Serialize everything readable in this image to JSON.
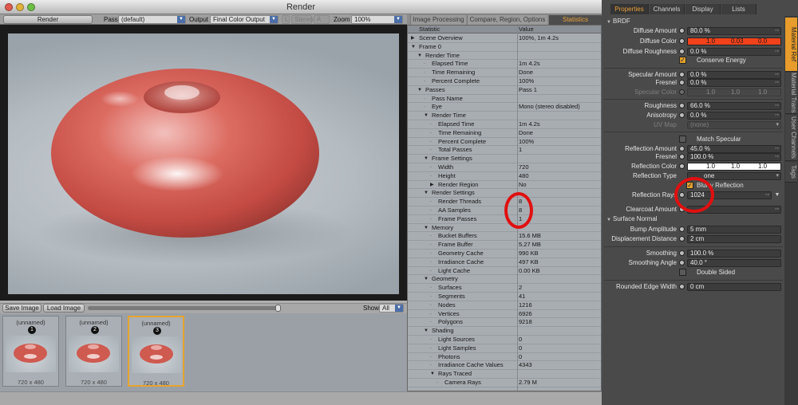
{
  "window": {
    "title": "Render"
  },
  "toolbar": {
    "render_button": "Render",
    "pass_label": "Pass",
    "pass_value": "(default)",
    "output_label": "Output",
    "output_value": "Final Color Output",
    "stereo_label": "Stereo",
    "zoom_label": "Zoom",
    "zoom_value": "100%"
  },
  "render_tabs": [
    "Image Processing",
    "Compare, Region, Options",
    "Statistics"
  ],
  "stats": {
    "headers": {
      "statistic": "Statistic",
      "value": "Value"
    },
    "rows": [
      {
        "name": "Scene Overview",
        "value": "100%, 1m 4.2s",
        "indent": 0,
        "toggle": "▶"
      },
      {
        "name": "Frame 0",
        "value": "",
        "indent": 0,
        "toggle": "▼"
      },
      {
        "name": "Render Time",
        "value": "",
        "indent": 1,
        "toggle": "▼"
      },
      {
        "name": "Elapsed Time",
        "value": "1m 4.2s",
        "indent": 2,
        "toggle": ""
      },
      {
        "name": "Time Remaining",
        "value": "Done",
        "indent": 2,
        "toggle": ""
      },
      {
        "name": "Percent Complete",
        "value": "100%",
        "indent": 2,
        "toggle": ""
      },
      {
        "name": "Passes",
        "value": "Pass 1",
        "indent": 1,
        "toggle": "▼"
      },
      {
        "name": "Pass Name",
        "value": "",
        "indent": 2,
        "toggle": ""
      },
      {
        "name": "Eye",
        "value": "Mono (stereo disabled)",
        "indent": 2,
        "toggle": ""
      },
      {
        "name": "Render Time",
        "value": "",
        "indent": 2,
        "toggle": "▼"
      },
      {
        "name": "Elapsed Time",
        "value": "1m 4.2s",
        "indent": 3,
        "toggle": ""
      },
      {
        "name": "Time Remaining",
        "value": "Done",
        "indent": 3,
        "toggle": ""
      },
      {
        "name": "Percent Complete",
        "value": "100%",
        "indent": 3,
        "toggle": ""
      },
      {
        "name": "Total Passes",
        "value": "1",
        "indent": 3,
        "toggle": ""
      },
      {
        "name": "Frame Settings",
        "value": "",
        "indent": 2,
        "toggle": "▼"
      },
      {
        "name": "Width",
        "value": "720",
        "indent": 3,
        "toggle": ""
      },
      {
        "name": "Height",
        "value": "480",
        "indent": 3,
        "toggle": ""
      },
      {
        "name": "Render Region",
        "value": "No",
        "indent": 3,
        "toggle": "▶"
      },
      {
        "name": "Render Settings",
        "value": "",
        "indent": 2,
        "toggle": "▼"
      },
      {
        "name": "Render Threads",
        "value": "8",
        "indent": 3,
        "toggle": ""
      },
      {
        "name": "AA Samples",
        "value": "8",
        "indent": 3,
        "toggle": ""
      },
      {
        "name": "Frame Passes",
        "value": "1",
        "indent": 3,
        "toggle": ""
      },
      {
        "name": "Memory",
        "value": "",
        "indent": 2,
        "toggle": "▼"
      },
      {
        "name": "Bucket Buffers",
        "value": "15.6 MB",
        "indent": 3,
        "toggle": ""
      },
      {
        "name": "Frame Buffer",
        "value": "5.27 MB",
        "indent": 3,
        "toggle": ""
      },
      {
        "name": "Geometry Cache",
        "value": "990 KB",
        "indent": 3,
        "toggle": ""
      },
      {
        "name": "Irradiance Cache",
        "value": "497 KB",
        "indent": 3,
        "toggle": ""
      },
      {
        "name": "Light Cache",
        "value": "0.00 KB",
        "indent": 3,
        "toggle": ""
      },
      {
        "name": "Geometry",
        "value": "",
        "indent": 2,
        "toggle": "▼"
      },
      {
        "name": "Surfaces",
        "value": "2",
        "indent": 3,
        "toggle": ""
      },
      {
        "name": "Segments",
        "value": "41",
        "indent": 3,
        "toggle": ""
      },
      {
        "name": "Nodes",
        "value": "1216",
        "indent": 3,
        "toggle": ""
      },
      {
        "name": "Vertices",
        "value": "6926",
        "indent": 3,
        "toggle": ""
      },
      {
        "name": "Polygons",
        "value": "9218",
        "indent": 3,
        "toggle": ""
      },
      {
        "name": "Shading",
        "value": "",
        "indent": 2,
        "toggle": "▼"
      },
      {
        "name": "Light Sources",
        "value": "0",
        "indent": 3,
        "toggle": ""
      },
      {
        "name": "Light Samples",
        "value": "0",
        "indent": 3,
        "toggle": ""
      },
      {
        "name": "Photons",
        "value": "0",
        "indent": 3,
        "toggle": ""
      },
      {
        "name": "Irradiance Cache Values",
        "value": "4343",
        "indent": 3,
        "toggle": ""
      },
      {
        "name": "Rays Traced",
        "value": "",
        "indent": 3,
        "toggle": "▼"
      },
      {
        "name": "Camera Rays",
        "value": "2.79 M",
        "indent": 4,
        "toggle": ""
      }
    ]
  },
  "bottom": {
    "save_image": "Save Image",
    "load_image": "Load Image",
    "show_label": "Show",
    "show_value": "All"
  },
  "thumbnails": [
    {
      "name": "(unnamed)",
      "number": "1",
      "dims": "720 x 480"
    },
    {
      "name": "(unnamed)",
      "number": "2",
      "dims": "720 x 480"
    },
    {
      "name": "(unnamed)",
      "number": "3",
      "dims": "720 x 480"
    }
  ],
  "props_tabs": [
    "Properties",
    "Channels",
    "Display",
    "Lists"
  ],
  "side_tabs": [
    "Material Ref",
    "Material Trans",
    "User Channels",
    "Tags"
  ],
  "props": {
    "brdf_label": "BRDF",
    "diffuse_amount_label": "Diffuse Amount",
    "diffuse_amount_value": "80.0 %",
    "diffuse_color_label": "Diffuse Color",
    "diffuse_color_values": [
      "1.0",
      "0.03",
      "0.0"
    ],
    "diffuse_roughness_label": "Diffuse Roughness",
    "diffuse_roughness_value": "0.0 %",
    "conserve_energy_label": "Conserve Energy",
    "specular_amount_label": "Specular Amount",
    "specular_amount_value": "0.0 %",
    "fresnel_label": "Fresnel",
    "fresnel_value": "0.0 %",
    "specular_color_label": "Specular Color",
    "specular_color_values": [
      "1.0",
      "1.0",
      "1.0"
    ],
    "roughness_label": "Roughness",
    "roughness_value": "66.0 %",
    "anisotropy_label": "Anisotropy",
    "anisotropy_value": "0.0 %",
    "uv_map_label": "UV Map",
    "uv_map_value": "(none)",
    "match_specular_label": "Match Specular",
    "reflection_amount_label": "Reflection Amount",
    "reflection_amount_value": "45.0 %",
    "fresnel2_label": "Fresnel",
    "fresnel2_value": "100.0 %",
    "reflection_color_label": "Reflection Color",
    "reflection_color_values": [
      "1.0",
      "1.0",
      "1.0"
    ],
    "reflection_type_label": "Reflection Type",
    "reflection_type_value": "one",
    "blurry_reflection_label": "Blurry Reflection",
    "reflection_rays_label": "Reflection Rays",
    "reflection_rays_value": "1024",
    "clearcoat_label": "Clearcoat Amount",
    "surface_normal_label": "Surface Normal",
    "bump_amplitude_label": "Bump Amplitude",
    "bump_amplitude_value": "5 mm",
    "displacement_label": "Displacement Distance",
    "displacement_value": "2 cm",
    "smoothing_label": "Smoothing",
    "smoothing_value": "100.0 %",
    "smoothing_angle_label": "Smoothing Angle",
    "smoothing_angle_value": "40.0 °",
    "double_sided_label": "Double Sided",
    "rounded_edge_label": "Rounded Edge Width",
    "rounded_edge_value": "0 cm"
  },
  "colors": {
    "accent": "#e79c2b",
    "diffuse": "#f2421b",
    "annotation": "#e01010"
  }
}
